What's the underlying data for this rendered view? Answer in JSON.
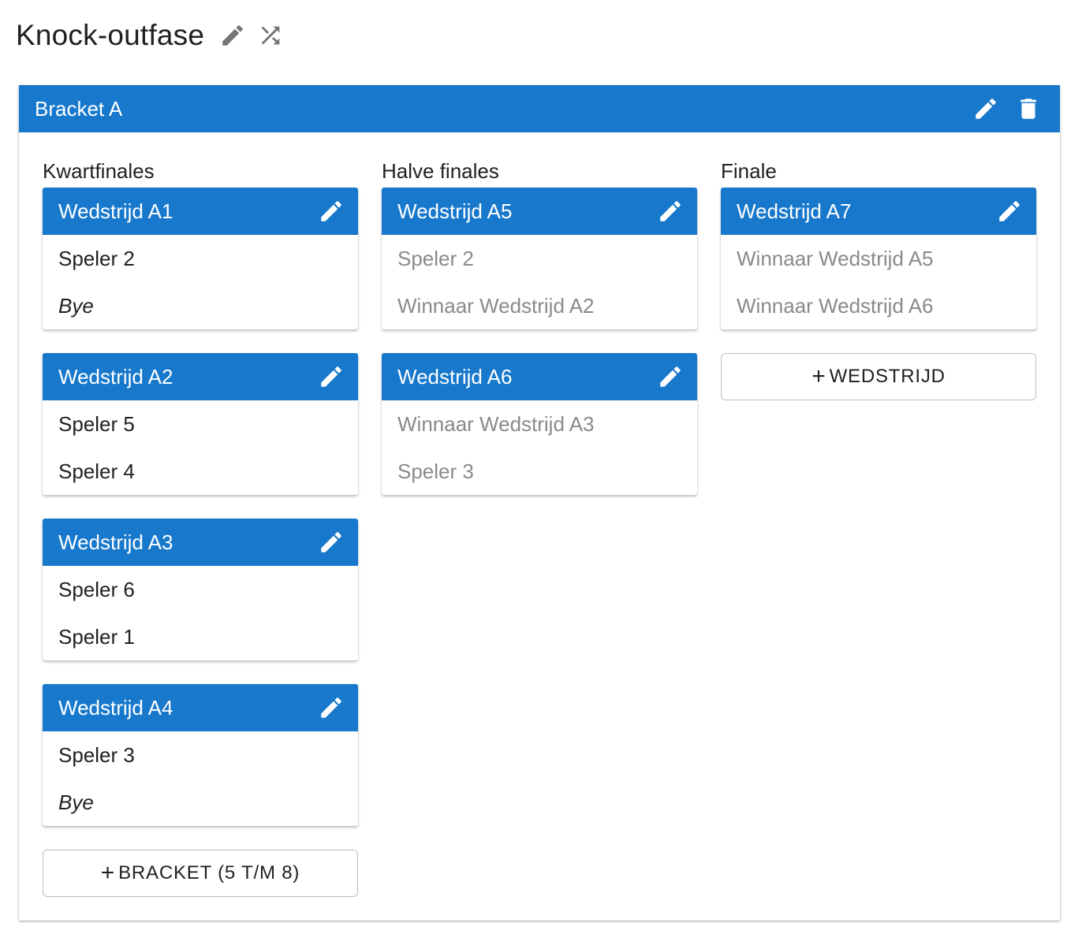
{
  "page": {
    "title": "Knock-outfase",
    "icons": [
      "pencil-icon",
      "shuffle-icon"
    ]
  },
  "bracket": {
    "title": "Bracket A",
    "header_color": "#1778cc",
    "icons": [
      "pencil-icon",
      "trash-icon"
    ],
    "rounds": [
      {
        "title": "Kwartfinales",
        "matches": [
          {
            "title": "Wedstrijd A1",
            "players": [
              {
                "name": "Speler 2",
                "style": "normal"
              },
              {
                "name": "Bye",
                "style": "bye"
              }
            ]
          },
          {
            "title": "Wedstrijd A2",
            "players": [
              {
                "name": "Speler 5",
                "style": "normal"
              },
              {
                "name": "Speler 4",
                "style": "normal"
              }
            ]
          },
          {
            "title": "Wedstrijd A3",
            "players": [
              {
                "name": "Speler 6",
                "style": "normal"
              },
              {
                "name": "Speler 1",
                "style": "normal"
              }
            ]
          },
          {
            "title": "Wedstrijd A4",
            "players": [
              {
                "name": "Speler 3",
                "style": "normal"
              },
              {
                "name": "Bye",
                "style": "bye"
              }
            ]
          }
        ],
        "add_button": {
          "plus": "+",
          "label": "BRACKET (5 T/M 8)"
        }
      },
      {
        "title": "Halve finales",
        "matches": [
          {
            "title": "Wedstrijd A5",
            "players": [
              {
                "name": "Speler 2",
                "style": "muted"
              },
              {
                "name": "Winnaar Wedstrijd A2",
                "style": "muted"
              }
            ]
          },
          {
            "title": "Wedstrijd A6",
            "players": [
              {
                "name": "Winnaar Wedstrijd A3",
                "style": "muted"
              },
              {
                "name": "Speler 3",
                "style": "muted"
              }
            ]
          }
        ]
      },
      {
        "title": "Finale",
        "matches": [
          {
            "title": "Wedstrijd A7",
            "players": [
              {
                "name": "Winnaar Wedstrijd A5",
                "style": "muted"
              },
              {
                "name": "Winnaar Wedstrijd A6",
                "style": "muted"
              }
            ]
          }
        ],
        "add_button": {
          "plus": "+",
          "label": "WEDSTRIJD"
        }
      }
    ]
  }
}
